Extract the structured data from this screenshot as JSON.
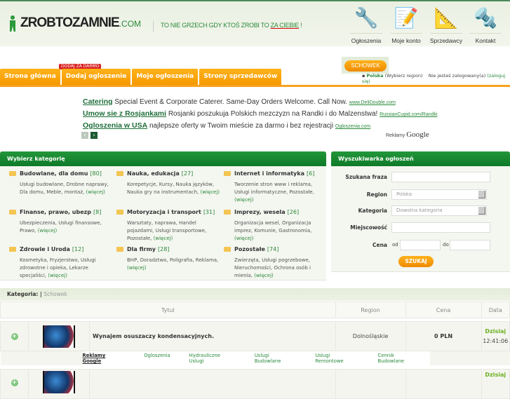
{
  "header": {
    "logo_name": "ZROBTOZAMNIE",
    "logo_tld": ".COM",
    "slogan_pre": "TO NIE GRZECH GDY KTOŚ ZROBI TO ",
    "slogan_emph": "ZA CIEBIE",
    "slogan_post": " !",
    "nav": [
      {
        "label": "Ogłoszenia",
        "icon": "tools-icon"
      },
      {
        "label": "Moje konto",
        "icon": "notepad-icon"
      },
      {
        "label": "Sprzedawcy",
        "icon": "drafting-icon"
      },
      {
        "label": "Kontakt",
        "icon": "drill-icon"
      }
    ]
  },
  "tabs": [
    {
      "label": "Strona główna"
    },
    {
      "label": "Dodaj ogloszenie"
    },
    {
      "label": "Moje ogłoszenia"
    },
    {
      "label": "Strony sprzedawców"
    }
  ],
  "badge": "DODAJ ZA DARMO",
  "schowek": "SCHOWEK",
  "region": {
    "name": "Polska",
    "change": "(Wybierz region)",
    "status": "Nie jesteś zalogowany(a)",
    "login": "(zaloguj się)"
  },
  "ads": [
    {
      "title": "Catering",
      "text": "Special Event & Corporate Caterer. Same-Day Orders Welcome. Call Now.",
      "url": "www.DeliDouble.com"
    },
    {
      "title": "Umow sie z Rosjankami",
      "text": "Rosjanki poszukuja Polskich mezczyzn na Randki i do Malzenstwa!",
      "url": "RussianCupid.com/Randki"
    },
    {
      "title": "Ogloszenia w USA",
      "text": "najlepsze oferty w Twoim mieście za darmo i bez rejestracji",
      "url": "Ogloszenia.com"
    }
  ],
  "ads_label": "Reklamy",
  "ads_brand": "Google",
  "categories": {
    "title": "Wybierz kategorię",
    "more": "(więcej)",
    "items": [
      {
        "name": "Budowlane, dla domu",
        "count": "[80]",
        "desc": "Usługi budowlane, Drobne naprawy, Dla domu, Meble, montaż,"
      },
      {
        "name": "Nauka, edukacja",
        "count": "[27]",
        "desc": "Korepetycje, Kursy, Nauka języków, Nauka gry na instrumentach,"
      },
      {
        "name": "Internet i informatyka",
        "count": "[6]",
        "desc": "Tworzenie stron www i reklama, Usługi informatyczne, Pozostałe,"
      },
      {
        "name": "Finanse, prawo, ubezp",
        "count": "[8]",
        "desc": "Ubezpieczenia, Usługi finansowe, Prawo,"
      },
      {
        "name": "Motoryzacja i transport",
        "count": "[31]",
        "desc": "Warsztaty, naprawa, Handel pojazdami, Usługi transportowe, Pozostałe,"
      },
      {
        "name": "Imprezy, wesela",
        "count": "[26]",
        "desc": "Organizacja wesel, Organizacja imprez, Komunie, Gastronomia,"
      },
      {
        "name": "Zdrowie i Uroda",
        "count": "[12]",
        "desc": "Kosmetyka, Fryzjerstwo, Usługi zdrowotne i opieka, Lekarze specjaliści,"
      },
      {
        "name": "Dla firmy",
        "count": "[28]",
        "desc": "BHP, Doradztwo, Poligrafia, Reklama,"
      },
      {
        "name": "Pozostałe",
        "count": "[74]",
        "desc": "Zwierzęta, Usługi pogrzebowe, Nieruchomości, Ochrona osób i mienia,"
      }
    ]
  },
  "search": {
    "title": "Wyszukiwarka ogłoszeń",
    "phrase_label": "Szukana fraza",
    "region_label": "Region",
    "region_value": "Polska",
    "category_label": "Kategoria",
    "category_value": "Dowolna kategoria",
    "city_label": "Miejscowość",
    "price_label": "Cena",
    "from": "od",
    "to": "do",
    "submit": "SZUKAJ"
  },
  "listing": {
    "kategoria_label": "Kategoria: |",
    "kategoria_value": "Schowek",
    "columns": [
      "Tytul",
      "Region",
      "Cena",
      "Data"
    ],
    "rows": [
      {
        "title": "Wynajem osuszaczy kondensacyjnych.",
        "region": "Dolnośląskie",
        "price": "0 PLN",
        "date": "Dzisiaj",
        "time": "12:41:06"
      },
      {
        "date": "Dzisiaj"
      }
    ],
    "google_ads_label": "Reklamy Google",
    "google_links": [
      "Ogloszenia",
      "Hydrauliczne Uslugi",
      "Uslugi Budowlane",
      "Uslugi Remontowe",
      "Cennik Budowlane"
    ]
  }
}
